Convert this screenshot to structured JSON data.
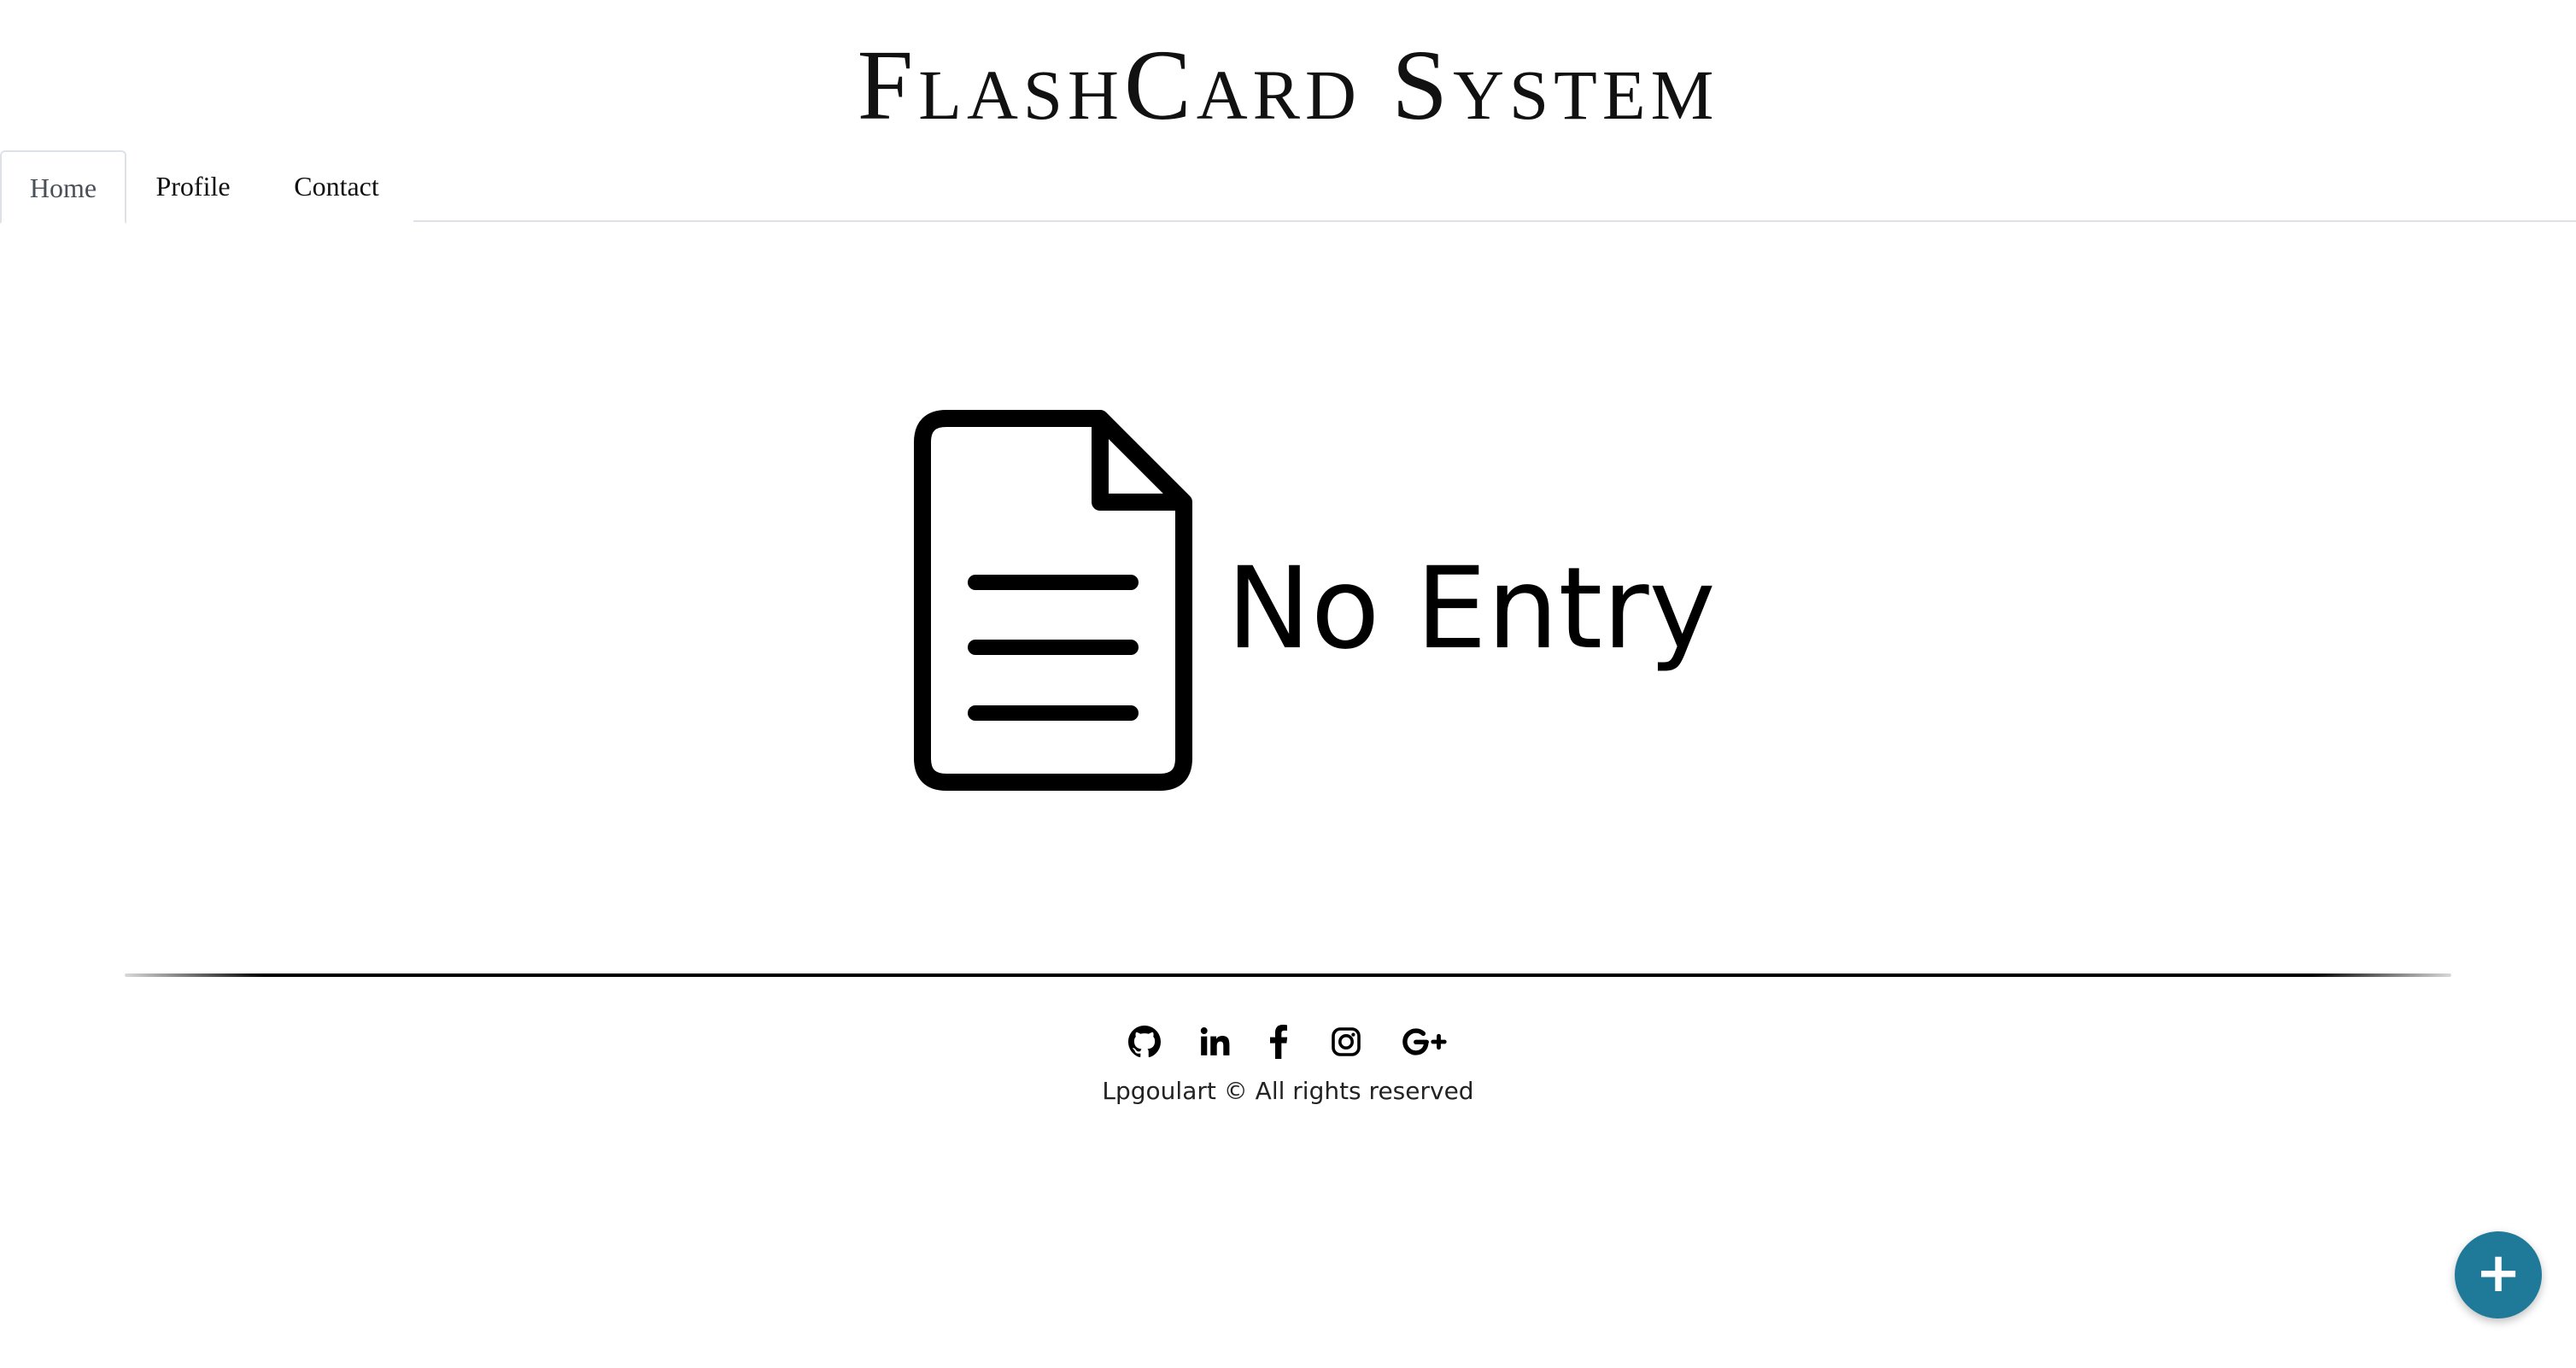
{
  "header": {
    "title": "FlashCard System"
  },
  "nav": {
    "tabs": [
      {
        "label": "Home",
        "active": true
      },
      {
        "label": "Profile",
        "active": false
      },
      {
        "label": "Contact",
        "active": false
      }
    ]
  },
  "main": {
    "empty_state": {
      "icon": "document-icon",
      "text": "No Entry"
    }
  },
  "footer": {
    "social_icons": [
      "github-icon",
      "linkedin-icon",
      "facebook-icon",
      "instagram-icon",
      "google-plus-icon"
    ],
    "copyright": "Lpgoulart © All rights reserved"
  },
  "fab": {
    "icon": "plus-icon",
    "symbol": "+",
    "color": "#1f7a99"
  }
}
